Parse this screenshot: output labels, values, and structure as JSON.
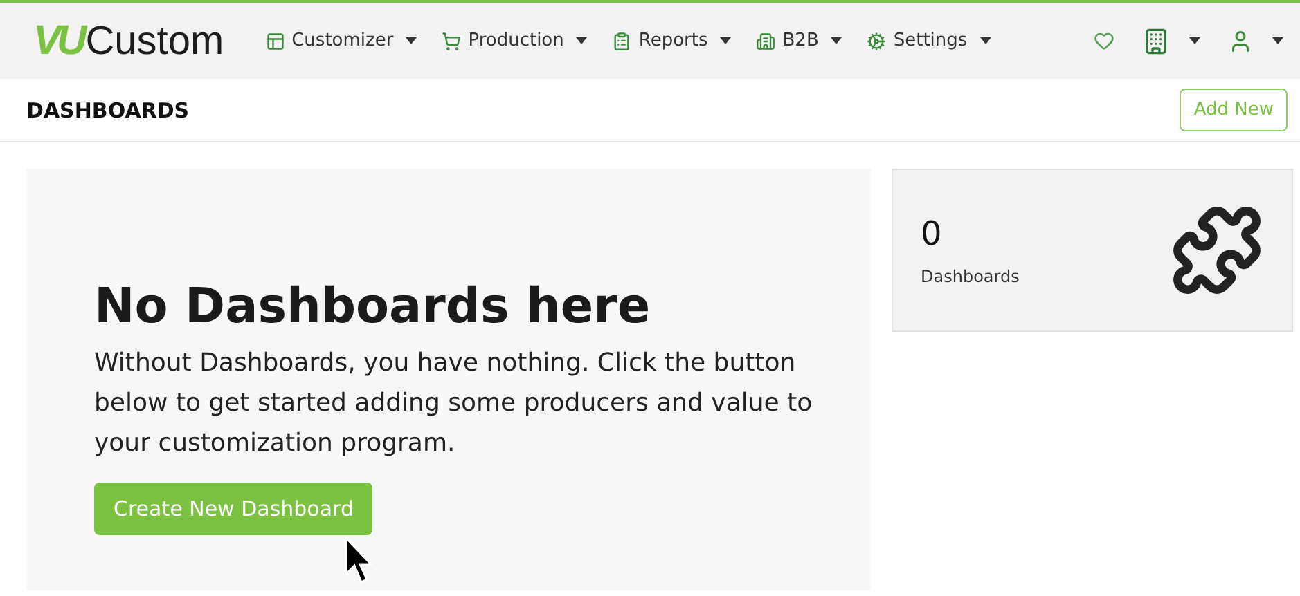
{
  "logo": {
    "mark": "VU",
    "name": "Custom"
  },
  "nav": [
    {
      "label": "Customizer"
    },
    {
      "label": "Production"
    },
    {
      "label": "Reports"
    },
    {
      "label": "B2B"
    },
    {
      "label": "Settings"
    }
  ],
  "page": {
    "title": "DASHBOARDS",
    "action": "Add New"
  },
  "empty": {
    "heading": "No Dashboards here",
    "text": "Without Dashboards, you have nothing. Click the button below to get started adding some producers and value to your customization program.",
    "button": "Create New Dashboard"
  },
  "stat": {
    "value": "0",
    "label": "Dashboards"
  }
}
